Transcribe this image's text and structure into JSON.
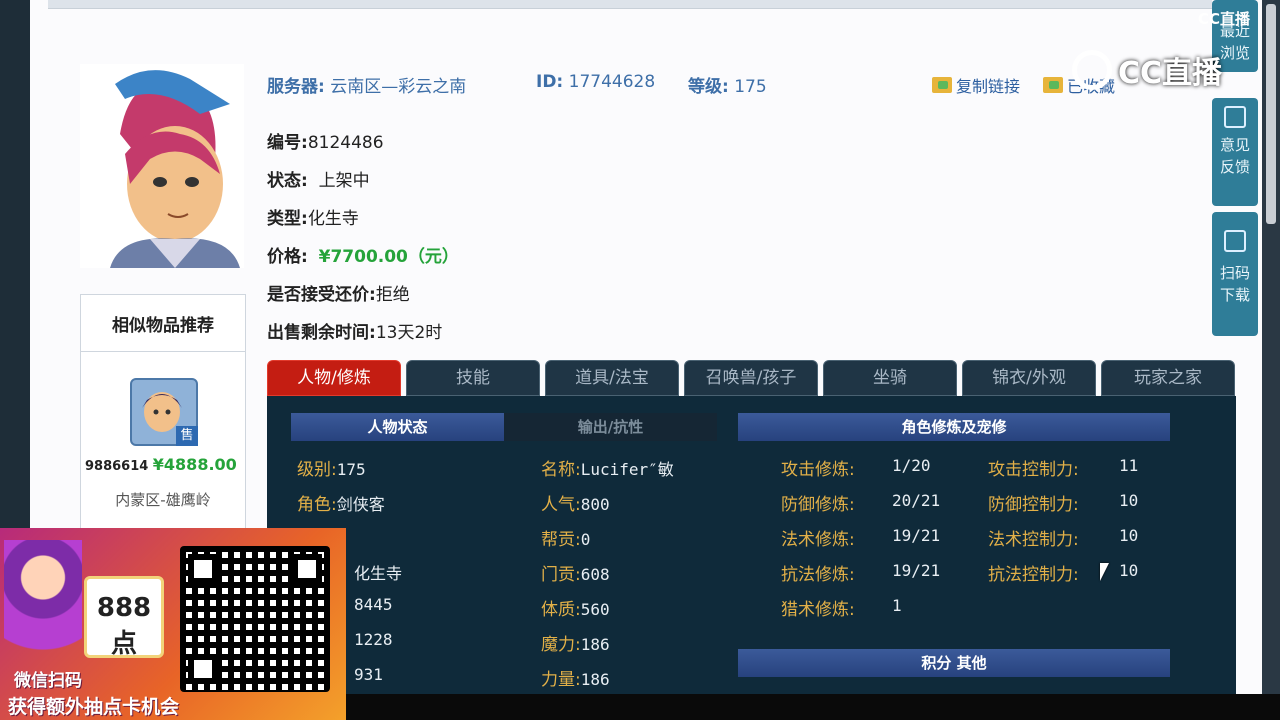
{
  "header": {
    "server_label": "服务器:",
    "server_value": "云南区—彩云之南",
    "id_label": "ID:",
    "id_value": "17744628",
    "level_label": "等级:",
    "level_value": "175",
    "copy_link": "复制链接",
    "collect": "已收藏"
  },
  "details": {
    "code_label": "编号:",
    "code_value": "8124486",
    "status_label": "状态:",
    "status_value": "上架中",
    "type_label": "类型:",
    "type_value": "化生寺",
    "price_label": "价格:",
    "price_value": "¥7700.00（元）",
    "bargain_label": "是否接受还价:",
    "bargain_value": "拒绝",
    "remaining_label": "出售剩余时间:",
    "remaining_value": "13天2时"
  },
  "similar": {
    "title": "相似物品推荐",
    "sale_badge": "售",
    "item_id": "9886614",
    "item_price": "¥4888.00",
    "item_server": "内蒙区-雄鹰岭"
  },
  "tabs": [
    "人物/修炼",
    "技能",
    "道具/法宝",
    "召唤兽/孩子",
    "坐骑",
    "锦衣/外观",
    "玩家之家"
  ],
  "status_panel": {
    "tab_active": "人物状态",
    "tab_inactive": "输出/抗性",
    "col1": [
      {
        "k": "级别:",
        "v": "175"
      },
      {
        "k": "角色:",
        "v": "剑侠客"
      },
      {
        "k": "",
        "v": ""
      },
      {
        "k": "",
        "v": "化生寺"
      },
      {
        "k": "",
        "v": "8445"
      },
      {
        "k": "",
        "v": "1228"
      },
      {
        "k": "",
        "v": "931"
      }
    ],
    "col2": [
      {
        "k": "名称:",
        "v": "Lucifer″敏"
      },
      {
        "k": "人气:",
        "v": "800"
      },
      {
        "k": "帮贡:",
        "v": "0"
      },
      {
        "k": "门贡:",
        "v": "608"
      },
      {
        "k": "体质:",
        "v": "560"
      },
      {
        "k": "魔力:",
        "v": "186"
      },
      {
        "k": "力量:",
        "v": "186"
      }
    ]
  },
  "cultivation": {
    "title": "角色修炼及宠修",
    "rows": [
      {
        "k": "攻击修炼:",
        "v": "1/20",
        "k2": "攻击控制力:",
        "v2": "11"
      },
      {
        "k": "防御修炼:",
        "v": "20/21",
        "k2": "防御控制力:",
        "v2": "10"
      },
      {
        "k": "法术修炼:",
        "v": "19/21",
        "k2": "法术控制力:",
        "v2": "10"
      },
      {
        "k": "抗法修炼:",
        "v": "19/21",
        "k2": "抗法控制力:",
        "v2": "10"
      },
      {
        "k": "猎术修炼:",
        "v": "1",
        "k2": "",
        "v2": ""
      }
    ],
    "points_title": "积分 其他"
  },
  "sidebar": {
    "recent": "最近浏览",
    "feedback_1": "意见",
    "feedback_2": "反馈",
    "scan_1": "扫码",
    "scan_2": "下载"
  },
  "watermark": {
    "small": "CC直播",
    "big": "CC直播"
  },
  "promo": {
    "card_value": "888点",
    "line1": "微信扫码",
    "line2": "获得额外抽点卡机会"
  }
}
